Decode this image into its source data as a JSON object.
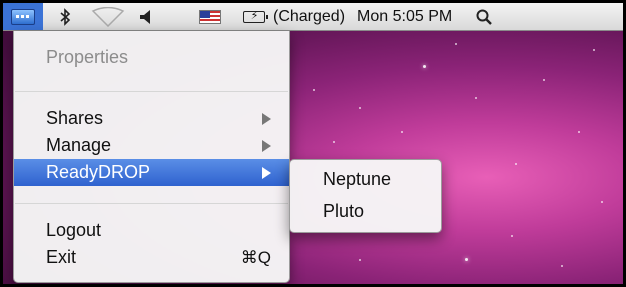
{
  "menubar": {
    "battery_status": "(Charged)",
    "clock": "Mon 5:05 PM",
    "icons": [
      "app-menu-icon",
      "bluetooth-icon",
      "wifi-icon",
      "volume-icon",
      "us-flag-icon",
      "battery-icon",
      "spotlight-search-icon"
    ]
  },
  "main_menu": {
    "items": [
      {
        "label": "Properties",
        "enabled": false
      },
      {
        "label": "Shares"
      },
      {
        "label": "Manage"
      },
      {
        "label": "ReadyDROP",
        "selected": true
      },
      {
        "label": "Logout"
      },
      {
        "label": "Exit",
        "shortcut": "⌘Q"
      }
    ]
  },
  "submenu": {
    "items": [
      {
        "label": "Neptune"
      },
      {
        "label": "Pluto"
      }
    ]
  },
  "colors": {
    "highlight": "#3a6fd8",
    "menubar_app_highlight": "#3b73d6",
    "desktop_pink": "#c03c9a"
  }
}
